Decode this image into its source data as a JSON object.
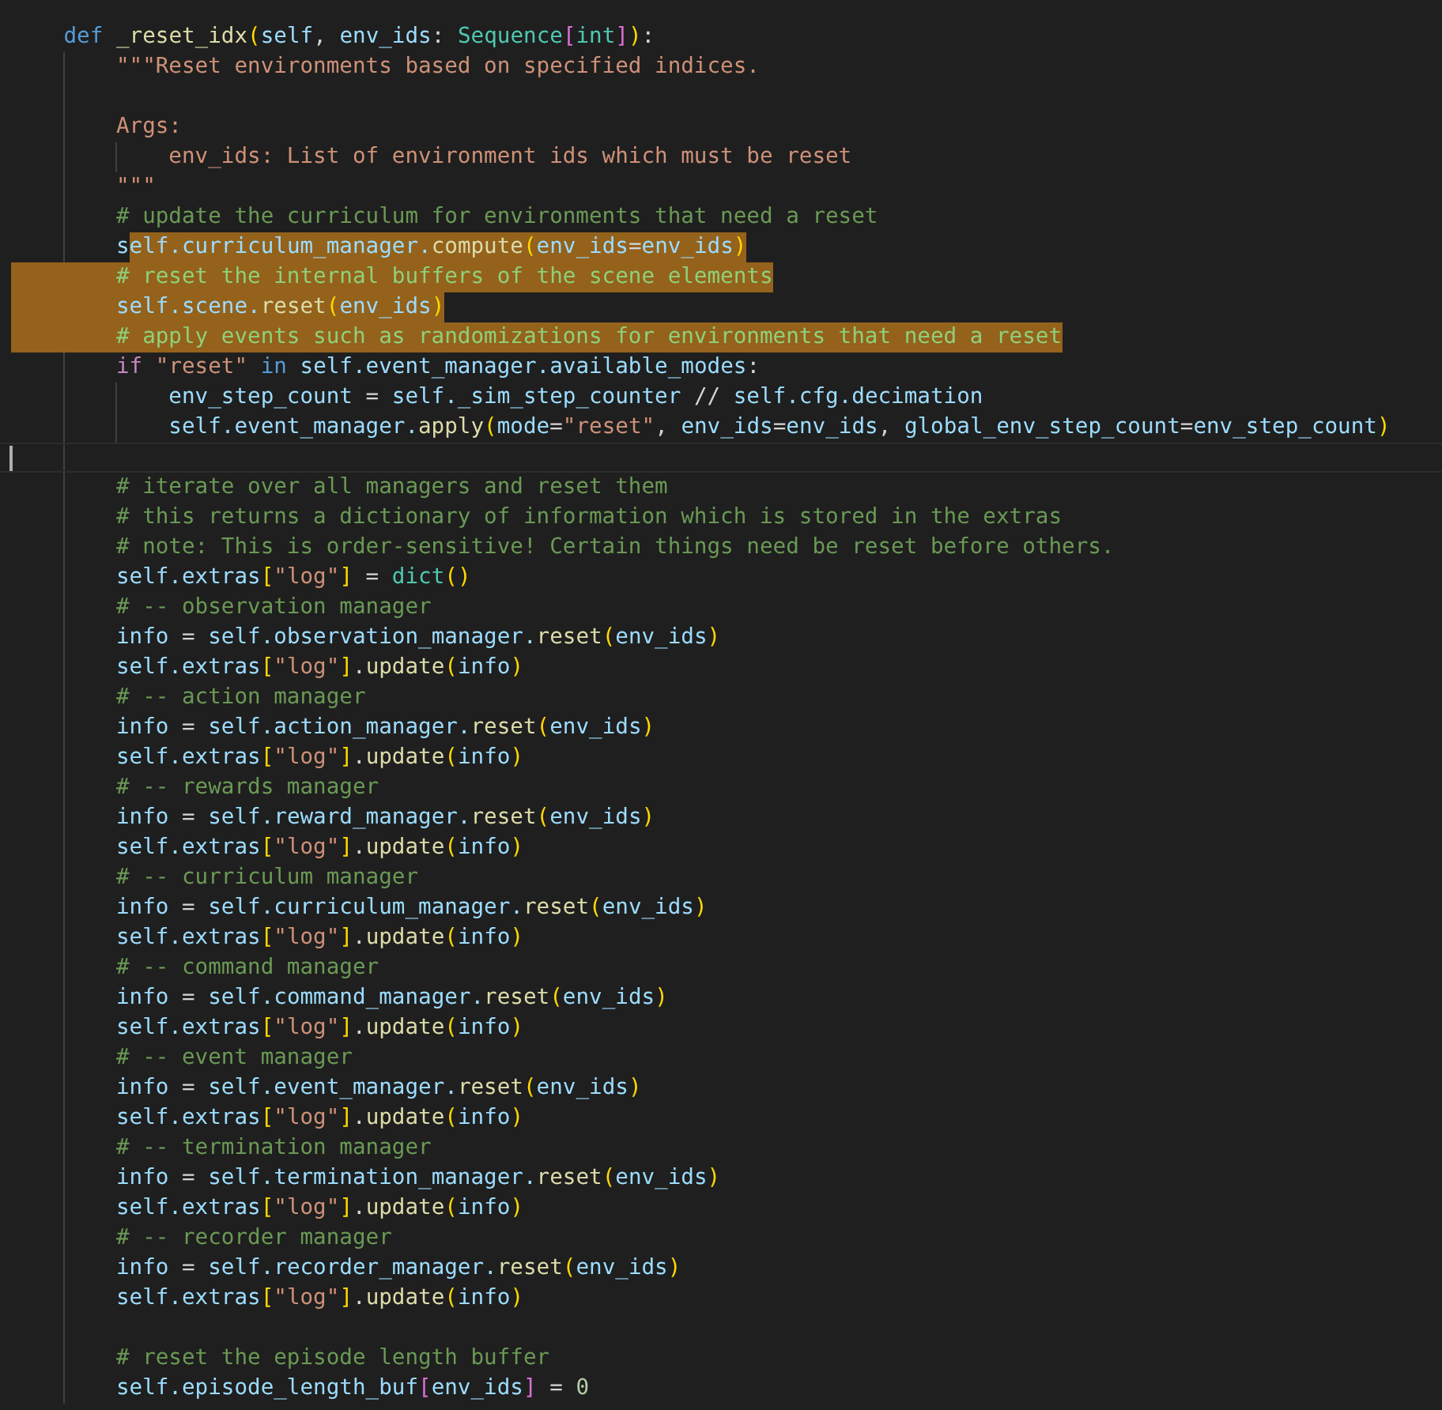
{
  "lines": [
    {
      "selected": false,
      "tokens": [
        {
          "kind": "kw",
          "text": "    def"
        },
        {
          "kind": "fn",
          "text": " _reset_idx"
        },
        {
          "kind": "br",
          "text": "("
        },
        {
          "kind": "var",
          "text": "self"
        },
        {
          "kind": "op",
          "text": ", "
        },
        {
          "kind": "var",
          "text": "env_ids"
        },
        {
          "kind": "op",
          "text": ": "
        },
        {
          "kind": "type",
          "text": "Sequence"
        },
        {
          "kind": "br2",
          "text": "["
        },
        {
          "kind": "type",
          "text": "int"
        },
        {
          "kind": "br2",
          "text": "]"
        },
        {
          "kind": "br",
          "text": ")"
        },
        {
          "kind": "op",
          "text": ":"
        }
      ]
    },
    {
      "selected": false,
      "tokens": [
        {
          "kind": "str",
          "text": "        \"\"\"Reset environments based on specified indices."
        }
      ]
    },
    {
      "selected": false
    },
    {
      "selected": false,
      "tokens": [
        {
          "kind": "str",
          "text": "        Args:"
        }
      ]
    },
    {
      "selected": false,
      "tokens": [
        {
          "kind": "str",
          "text": "            env_ids: List of environment ids which must be reset"
        }
      ]
    },
    {
      "selected": false,
      "tokens": [
        {
          "kind": "str",
          "text": "        \"\"\""
        }
      ]
    },
    {
      "selected": false,
      "tokens": [
        {
          "kind": "cmt",
          "text": "        # update the curriculum for environments that need a reset"
        }
      ]
    },
    {
      "selected": true,
      "lead_tokens": [
        {
          "kind": "var",
          "text": "        s"
        }
      ],
      "tokens": [
        {
          "kind": "var",
          "text": "elf.curriculum_manager."
        },
        {
          "kind": "fn",
          "text": "compute"
        },
        {
          "kind": "br",
          "text": "("
        },
        {
          "kind": "var",
          "text": "env_ids"
        },
        {
          "kind": "op",
          "text": "="
        },
        {
          "kind": "var",
          "text": "env_ids"
        },
        {
          "kind": "br",
          "text": ")"
        }
      ]
    },
    {
      "selected": true,
      "tokens": [
        {
          "kind": "cmt",
          "text": "        # reset the internal buffers of the scene elements"
        }
      ]
    },
    {
      "selected": true,
      "tokens": [
        {
          "kind": "var",
          "text": "        self.scene."
        },
        {
          "kind": "fn",
          "text": "reset"
        },
        {
          "kind": "br",
          "text": "("
        },
        {
          "kind": "var",
          "text": "env_ids"
        },
        {
          "kind": "br",
          "text": ")"
        }
      ]
    },
    {
      "selected": true,
      "tokens": [
        {
          "kind": "cmt",
          "text": "        # apply events such as randomizations for environments that need a reset"
        }
      ]
    },
    {
      "selected": false,
      "tokens": [
        {
          "kind": "ctrl",
          "text": "        if"
        },
        {
          "kind": "str",
          "text": " \"reset\""
        },
        {
          "kind": "kw",
          "text": " in"
        },
        {
          "kind": "var",
          "text": " self.event_manager.available_modes"
        },
        {
          "kind": "op",
          "text": ":"
        }
      ]
    },
    {
      "selected": false,
      "tokens": [
        {
          "kind": "var",
          "text": "            env_step_count"
        },
        {
          "kind": "op",
          "text": " = "
        },
        {
          "kind": "var",
          "text": "self._sim_step_counter"
        },
        {
          "kind": "op",
          "text": " // "
        },
        {
          "kind": "var",
          "text": "self.cfg.decimation"
        }
      ]
    },
    {
      "selected": false,
      "tokens": [
        {
          "kind": "var",
          "text": "            self.event_manager."
        },
        {
          "kind": "fn",
          "text": "apply"
        },
        {
          "kind": "br",
          "text": "("
        },
        {
          "kind": "var",
          "text": "mode"
        },
        {
          "kind": "op",
          "text": "="
        },
        {
          "kind": "str",
          "text": "\"reset\""
        },
        {
          "kind": "op",
          "text": ", "
        },
        {
          "kind": "var",
          "text": "env_ids"
        },
        {
          "kind": "op",
          "text": "="
        },
        {
          "kind": "var",
          "text": "env_ids"
        },
        {
          "kind": "op",
          "text": ", "
        },
        {
          "kind": "var",
          "text": "global_env_step_count"
        },
        {
          "kind": "op",
          "text": "="
        },
        {
          "kind": "var",
          "text": "env_step_count"
        },
        {
          "kind": "br",
          "text": ")"
        }
      ]
    },
    {
      "selected": false,
      "current": true
    },
    {
      "selected": false,
      "tokens": [
        {
          "kind": "cmt",
          "text": "        # iterate over all managers and reset them"
        }
      ]
    },
    {
      "selected": false,
      "tokens": [
        {
          "kind": "cmt",
          "text": "        # this returns a dictionary of information which is stored in the extras"
        }
      ]
    },
    {
      "selected": false,
      "tokens": [
        {
          "kind": "cmt",
          "text": "        # note: This is order-sensitive! Certain things need be reset before others."
        }
      ]
    },
    {
      "selected": false,
      "tokens": [
        {
          "kind": "var",
          "text": "        self.extras"
        },
        {
          "kind": "br",
          "text": "["
        },
        {
          "kind": "str",
          "text": "\"log\""
        },
        {
          "kind": "br",
          "text": "]"
        },
        {
          "kind": "op",
          "text": " = "
        },
        {
          "kind": "type",
          "text": "dict"
        },
        {
          "kind": "br",
          "text": "()"
        }
      ]
    },
    {
      "selected": false,
      "tokens": [
        {
          "kind": "cmt",
          "text": "        # -- observation manager"
        }
      ]
    },
    {
      "selected": false,
      "tokens": [
        {
          "kind": "var",
          "text": "        info"
        },
        {
          "kind": "op",
          "text": " = "
        },
        {
          "kind": "var",
          "text": "self.observation_manager."
        },
        {
          "kind": "fn",
          "text": "reset"
        },
        {
          "kind": "br",
          "text": "("
        },
        {
          "kind": "var",
          "text": "env_ids"
        },
        {
          "kind": "br",
          "text": ")"
        }
      ]
    },
    {
      "selected": false,
      "tokens": [
        {
          "kind": "var",
          "text": "        self.extras"
        },
        {
          "kind": "br",
          "text": "["
        },
        {
          "kind": "str",
          "text": "\"log\""
        },
        {
          "kind": "br",
          "text": "]"
        },
        {
          "kind": "op",
          "text": "."
        },
        {
          "kind": "fn",
          "text": "update"
        },
        {
          "kind": "br",
          "text": "("
        },
        {
          "kind": "var",
          "text": "info"
        },
        {
          "kind": "br",
          "text": ")"
        }
      ]
    },
    {
      "selected": false,
      "tokens": [
        {
          "kind": "cmt",
          "text": "        # -- action manager"
        }
      ]
    },
    {
      "selected": false,
      "tokens": [
        {
          "kind": "var",
          "text": "        info"
        },
        {
          "kind": "op",
          "text": " = "
        },
        {
          "kind": "var",
          "text": "self.action_manager."
        },
        {
          "kind": "fn",
          "text": "reset"
        },
        {
          "kind": "br",
          "text": "("
        },
        {
          "kind": "var",
          "text": "env_ids"
        },
        {
          "kind": "br",
          "text": ")"
        }
      ]
    },
    {
      "selected": false,
      "tokens": [
        {
          "kind": "var",
          "text": "        self.extras"
        },
        {
          "kind": "br",
          "text": "["
        },
        {
          "kind": "str",
          "text": "\"log\""
        },
        {
          "kind": "br",
          "text": "]"
        },
        {
          "kind": "op",
          "text": "."
        },
        {
          "kind": "fn",
          "text": "update"
        },
        {
          "kind": "br",
          "text": "("
        },
        {
          "kind": "var",
          "text": "info"
        },
        {
          "kind": "br",
          "text": ")"
        }
      ]
    },
    {
      "selected": false,
      "tokens": [
        {
          "kind": "cmt",
          "text": "        # -- rewards manager"
        }
      ]
    },
    {
      "selected": false,
      "tokens": [
        {
          "kind": "var",
          "text": "        info"
        },
        {
          "kind": "op",
          "text": " = "
        },
        {
          "kind": "var",
          "text": "self.reward_manager."
        },
        {
          "kind": "fn",
          "text": "reset"
        },
        {
          "kind": "br",
          "text": "("
        },
        {
          "kind": "var",
          "text": "env_ids"
        },
        {
          "kind": "br",
          "text": ")"
        }
      ]
    },
    {
      "selected": false,
      "tokens": [
        {
          "kind": "var",
          "text": "        self.extras"
        },
        {
          "kind": "br",
          "text": "["
        },
        {
          "kind": "str",
          "text": "\"log\""
        },
        {
          "kind": "br",
          "text": "]"
        },
        {
          "kind": "op",
          "text": "."
        },
        {
          "kind": "fn",
          "text": "update"
        },
        {
          "kind": "br",
          "text": "("
        },
        {
          "kind": "var",
          "text": "info"
        },
        {
          "kind": "br",
          "text": ")"
        }
      ]
    },
    {
      "selected": false,
      "tokens": [
        {
          "kind": "cmt",
          "text": "        # -- curriculum manager"
        }
      ]
    },
    {
      "selected": false,
      "tokens": [
        {
          "kind": "var",
          "text": "        info"
        },
        {
          "kind": "op",
          "text": " = "
        },
        {
          "kind": "var",
          "text": "self.curriculum_manager."
        },
        {
          "kind": "fn",
          "text": "reset"
        },
        {
          "kind": "br",
          "text": "("
        },
        {
          "kind": "var",
          "text": "env_ids"
        },
        {
          "kind": "br",
          "text": ")"
        }
      ]
    },
    {
      "selected": false,
      "tokens": [
        {
          "kind": "var",
          "text": "        self.extras"
        },
        {
          "kind": "br",
          "text": "["
        },
        {
          "kind": "str",
          "text": "\"log\""
        },
        {
          "kind": "br",
          "text": "]"
        },
        {
          "kind": "op",
          "text": "."
        },
        {
          "kind": "fn",
          "text": "update"
        },
        {
          "kind": "br",
          "text": "("
        },
        {
          "kind": "var",
          "text": "info"
        },
        {
          "kind": "br",
          "text": ")"
        }
      ]
    },
    {
      "selected": false,
      "tokens": [
        {
          "kind": "cmt",
          "text": "        # -- command manager"
        }
      ]
    },
    {
      "selected": false,
      "tokens": [
        {
          "kind": "var",
          "text": "        info"
        },
        {
          "kind": "op",
          "text": " = "
        },
        {
          "kind": "var",
          "text": "self.command_manager."
        },
        {
          "kind": "fn",
          "text": "reset"
        },
        {
          "kind": "br",
          "text": "("
        },
        {
          "kind": "var",
          "text": "env_ids"
        },
        {
          "kind": "br",
          "text": ")"
        }
      ]
    },
    {
      "selected": false,
      "tokens": [
        {
          "kind": "var",
          "text": "        self.extras"
        },
        {
          "kind": "br",
          "text": "["
        },
        {
          "kind": "str",
          "text": "\"log\""
        },
        {
          "kind": "br",
          "text": "]"
        },
        {
          "kind": "op",
          "text": "."
        },
        {
          "kind": "fn",
          "text": "update"
        },
        {
          "kind": "br",
          "text": "("
        },
        {
          "kind": "var",
          "text": "info"
        },
        {
          "kind": "br",
          "text": ")"
        }
      ]
    },
    {
      "selected": false,
      "tokens": [
        {
          "kind": "cmt",
          "text": "        # -- event manager"
        }
      ]
    },
    {
      "selected": false,
      "tokens": [
        {
          "kind": "var",
          "text": "        info"
        },
        {
          "kind": "op",
          "text": " = "
        },
        {
          "kind": "var",
          "text": "self.event_manager."
        },
        {
          "kind": "fn",
          "text": "reset"
        },
        {
          "kind": "br",
          "text": "("
        },
        {
          "kind": "var",
          "text": "env_ids"
        },
        {
          "kind": "br",
          "text": ")"
        }
      ]
    },
    {
      "selected": false,
      "tokens": [
        {
          "kind": "var",
          "text": "        self.extras"
        },
        {
          "kind": "br",
          "text": "["
        },
        {
          "kind": "str",
          "text": "\"log\""
        },
        {
          "kind": "br",
          "text": "]"
        },
        {
          "kind": "op",
          "text": "."
        },
        {
          "kind": "fn",
          "text": "update"
        },
        {
          "kind": "br",
          "text": "("
        },
        {
          "kind": "var",
          "text": "info"
        },
        {
          "kind": "br",
          "text": ")"
        }
      ]
    },
    {
      "selected": false,
      "tokens": [
        {
          "kind": "cmt",
          "text": "        # -- termination manager"
        }
      ]
    },
    {
      "selected": false,
      "tokens": [
        {
          "kind": "var",
          "text": "        info"
        },
        {
          "kind": "op",
          "text": " = "
        },
        {
          "kind": "var",
          "text": "self.termination_manager."
        },
        {
          "kind": "fn",
          "text": "reset"
        },
        {
          "kind": "br",
          "text": "("
        },
        {
          "kind": "var",
          "text": "env_ids"
        },
        {
          "kind": "br",
          "text": ")"
        }
      ]
    },
    {
      "selected": false,
      "tokens": [
        {
          "kind": "var",
          "text": "        self.extras"
        },
        {
          "kind": "br",
          "text": "["
        },
        {
          "kind": "str",
          "text": "\"log\""
        },
        {
          "kind": "br",
          "text": "]"
        },
        {
          "kind": "op",
          "text": "."
        },
        {
          "kind": "fn",
          "text": "update"
        },
        {
          "kind": "br",
          "text": "("
        },
        {
          "kind": "var",
          "text": "info"
        },
        {
          "kind": "br",
          "text": ")"
        }
      ]
    },
    {
      "selected": false,
      "tokens": [
        {
          "kind": "cmt",
          "text": "        # -- recorder manager"
        }
      ]
    },
    {
      "selected": false,
      "tokens": [
        {
          "kind": "var",
          "text": "        info"
        },
        {
          "kind": "op",
          "text": " = "
        },
        {
          "kind": "var",
          "text": "self.recorder_manager."
        },
        {
          "kind": "fn",
          "text": "reset"
        },
        {
          "kind": "br",
          "text": "("
        },
        {
          "kind": "var",
          "text": "env_ids"
        },
        {
          "kind": "br",
          "text": ")"
        }
      ]
    },
    {
      "selected": false,
      "tokens": [
        {
          "kind": "var",
          "text": "        self.extras"
        },
        {
          "kind": "br",
          "text": "["
        },
        {
          "kind": "str",
          "text": "\"log\""
        },
        {
          "kind": "br",
          "text": "]"
        },
        {
          "kind": "op",
          "text": "."
        },
        {
          "kind": "fn",
          "text": "update"
        },
        {
          "kind": "br",
          "text": "("
        },
        {
          "kind": "var",
          "text": "info"
        },
        {
          "kind": "br",
          "text": ")"
        }
      ]
    },
    {
      "selected": false
    },
    {
      "selected": false,
      "tokens": [
        {
          "kind": "cmt",
          "text": "        # reset the episode length buffer"
        }
      ]
    },
    {
      "selected": false,
      "tokens": [
        {
          "kind": "var",
          "text": "        self.episode_length_buf"
        },
        {
          "kind": "br2",
          "text": "["
        },
        {
          "kind": "var",
          "text": "env_ids"
        },
        {
          "kind": "br2",
          "text": "]"
        },
        {
          "kind": "op",
          "text": " = "
        },
        {
          "kind": "num",
          "text": "0"
        }
      ]
    }
  ]
}
